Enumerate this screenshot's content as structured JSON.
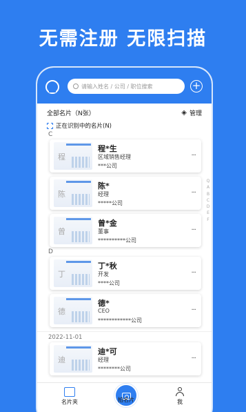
{
  "headline": "无需注册 无限扫描",
  "search": {
    "placeholder": "请输入姓名 / 公司 / 职位搜索"
  },
  "list_header": {
    "title": "全部名片（N张）",
    "manage_label": "管理"
  },
  "recognizing_label": "正在识别中的名片(N)",
  "groups": {
    "c": "C",
    "d": "D",
    "date": "2022-11-01"
  },
  "cards": [
    {
      "thumb": "程",
      "name": "程*生",
      "title": "区域销售经理",
      "company": "***公司"
    },
    {
      "thumb": "陈",
      "name": "陈*",
      "title": "经理",
      "company": "*****公司"
    },
    {
      "thumb": "曾",
      "name": "曾*金",
      "title": "董事",
      "company": "**********公司"
    },
    {
      "thumb": "丁",
      "name": "丁*秋",
      "title": "开发",
      "company": "****公司"
    },
    {
      "thumb": "德",
      "name": "德*",
      "title": "CEO",
      "company": "************公司"
    },
    {
      "thumb": "迪",
      "name": "迪*可",
      "title": "经理",
      "company": "********公司"
    }
  ],
  "more_label": "···",
  "alpha_index": [
    "Q",
    "A",
    "B",
    "C",
    "D",
    "E",
    "F"
  ],
  "tabs": {
    "cards": "名片夹",
    "scan": "拍名片",
    "me": "我"
  },
  "colors": {
    "brand": "#2e7ef0"
  }
}
